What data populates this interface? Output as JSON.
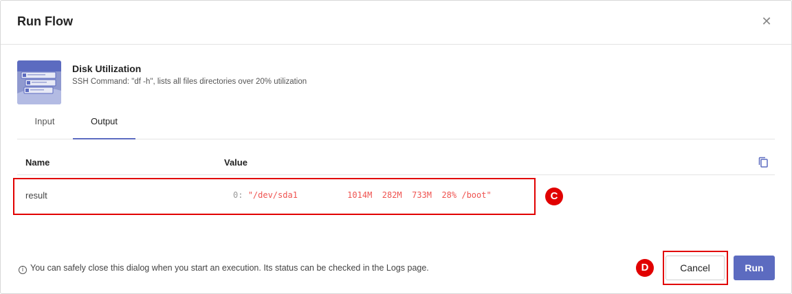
{
  "dialog": {
    "title": "Run Flow",
    "close_icon": "close-icon"
  },
  "flow": {
    "name": "Disk Utilization",
    "description": "SSH Command: \"df -h\", lists all files directories over 20% utilization"
  },
  "tabs": [
    {
      "label": "Input",
      "active": false
    },
    {
      "label": "Output",
      "active": true
    }
  ],
  "table": {
    "headers": {
      "name": "Name",
      "value": "Value"
    },
    "rows": [
      {
        "name": "result",
        "index": "0:",
        "value": "\"/dev/sda1          1014M  282M  733M  28% /boot\""
      }
    ]
  },
  "annotations": {
    "c": "C",
    "d": "D"
  },
  "footer": {
    "note": "You can safely close this dialog when you start an execution. Its status can be checked in the Logs page.",
    "cancel_label": "Cancel",
    "run_label": "Run"
  },
  "colors": {
    "accent": "#5c6bc0",
    "value_text": "#ef5350",
    "highlight": "#e10000"
  }
}
